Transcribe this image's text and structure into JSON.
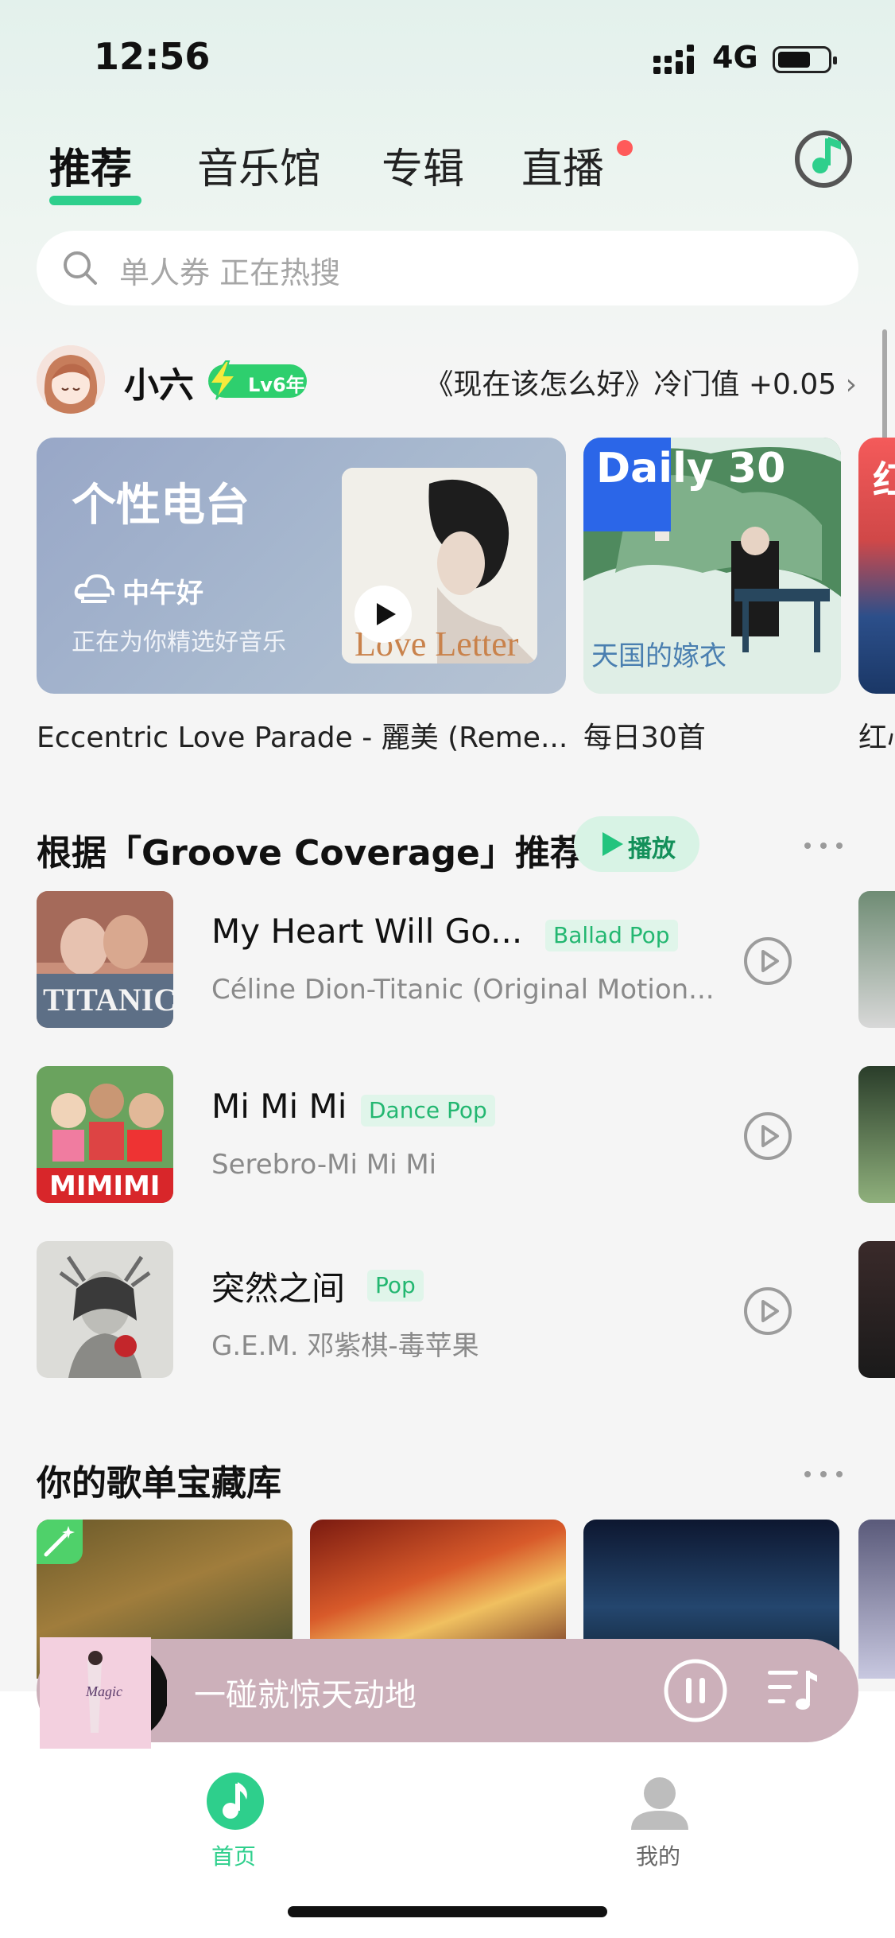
{
  "status_bar": {
    "time": "12:56",
    "network": "4G"
  },
  "tabs": [
    {
      "label": "推荐",
      "active": true
    },
    {
      "label": "音乐馆",
      "active": false
    },
    {
      "label": "专辑",
      "active": false
    },
    {
      "label": "直播",
      "active": false,
      "has_dot": true
    }
  ],
  "search": {
    "placeholder": "单人券  正在热搜"
  },
  "user": {
    "name": "小六",
    "level_badge": "Lv6年",
    "coldness_text": "《现在该怎么好》冷门值 +0.05"
  },
  "featured": {
    "radio": {
      "title": "个性电台",
      "greeting": "中午好",
      "subtitle": "正在为你精选好音乐",
      "cover_text": "Love Letter",
      "caption": "Eccentric Love Parade - 麗美 (Reme..."
    },
    "daily": {
      "logo": "Daily 30",
      "caption": "每日30首"
    },
    "third": {
      "logo_char": "红",
      "caption": "红心"
    }
  },
  "recommend_section": {
    "title": "根据「Groove Coverage」推荐",
    "play_label": "播放"
  },
  "songs": [
    {
      "name": "My Heart Will Go...",
      "tag": "Ballad Pop",
      "artist": "Céline Dion-Titanic (Original Motion..."
    },
    {
      "name": "Mi Mi Mi",
      "tag": "Dance Pop",
      "artist": "Serebro-Mi Mi Mi"
    },
    {
      "name": "突然之间",
      "tag": "Pop",
      "artist": "G.E.M. 邓紫棋-毒苹果"
    }
  ],
  "playlist_section": {
    "title": "你的歌单宝藏库"
  },
  "player": {
    "title": "一碰就惊天动地"
  },
  "bottom_nav": [
    {
      "label": "首页",
      "active": true
    },
    {
      "label": "我的",
      "active": false
    }
  ],
  "colors": {
    "accent": "#2ecf8c",
    "tag_text": "#23b771",
    "player_bg": "#ccb0ba",
    "dot": "#ff5a5a"
  }
}
